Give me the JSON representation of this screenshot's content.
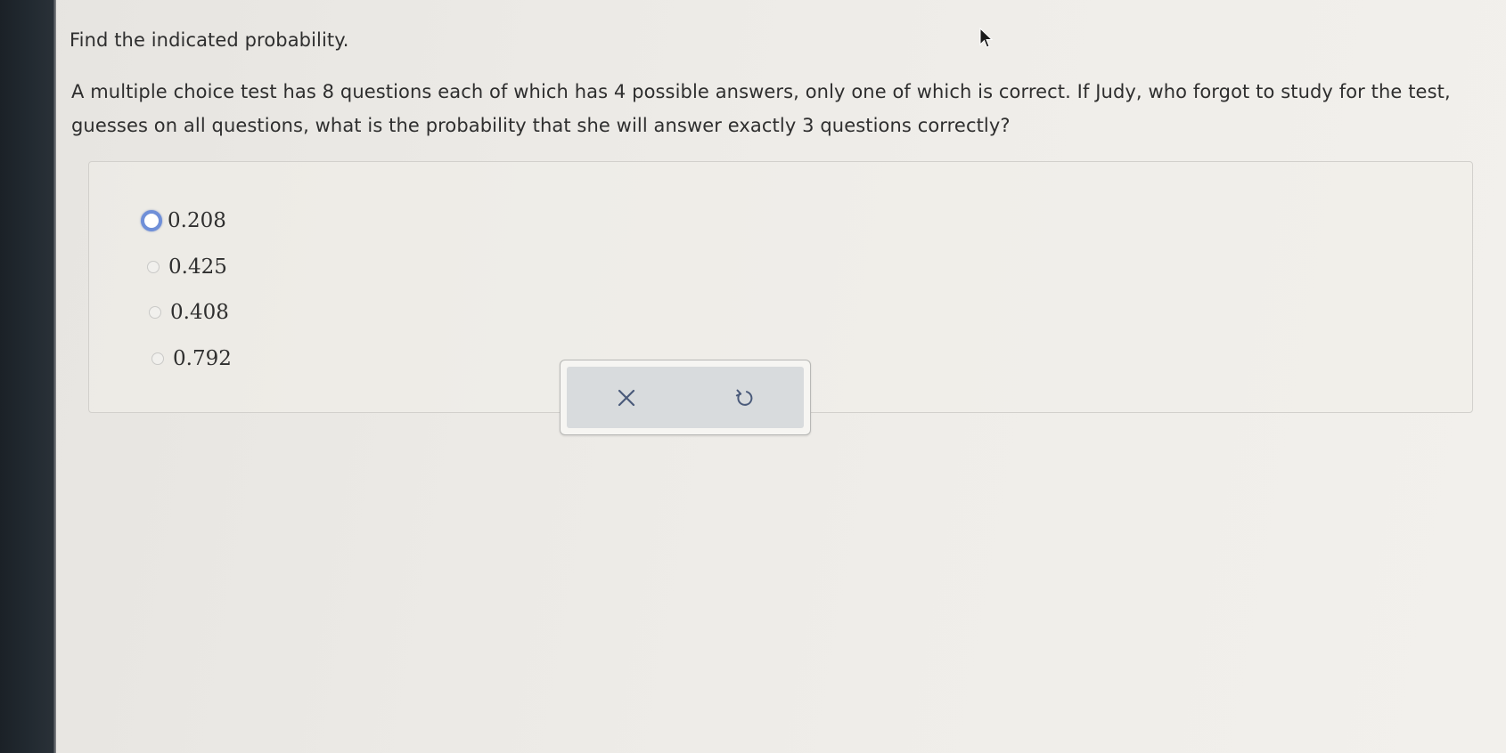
{
  "prompt": {
    "instruction": "Find the indicated probability.",
    "question": "A multiple choice test has 8 questions each of which has 4 possible answers, only one of which is correct. If Judy, who forgot to study for the test, guesses on all questions, what is the probability that she will answer exactly 3 questions correctly?"
  },
  "options": [
    {
      "label": "0.208",
      "selected": true
    },
    {
      "label": "0.425",
      "selected": false
    },
    {
      "label": "0.408",
      "selected": false
    },
    {
      "label": "0.792",
      "selected": false
    }
  ],
  "actions": {
    "clear_icon": "x-icon",
    "undo_icon": "undo-icon"
  },
  "colors": {
    "selected_radio": "#6f8fd8",
    "action_background": "#d8dbdd"
  }
}
